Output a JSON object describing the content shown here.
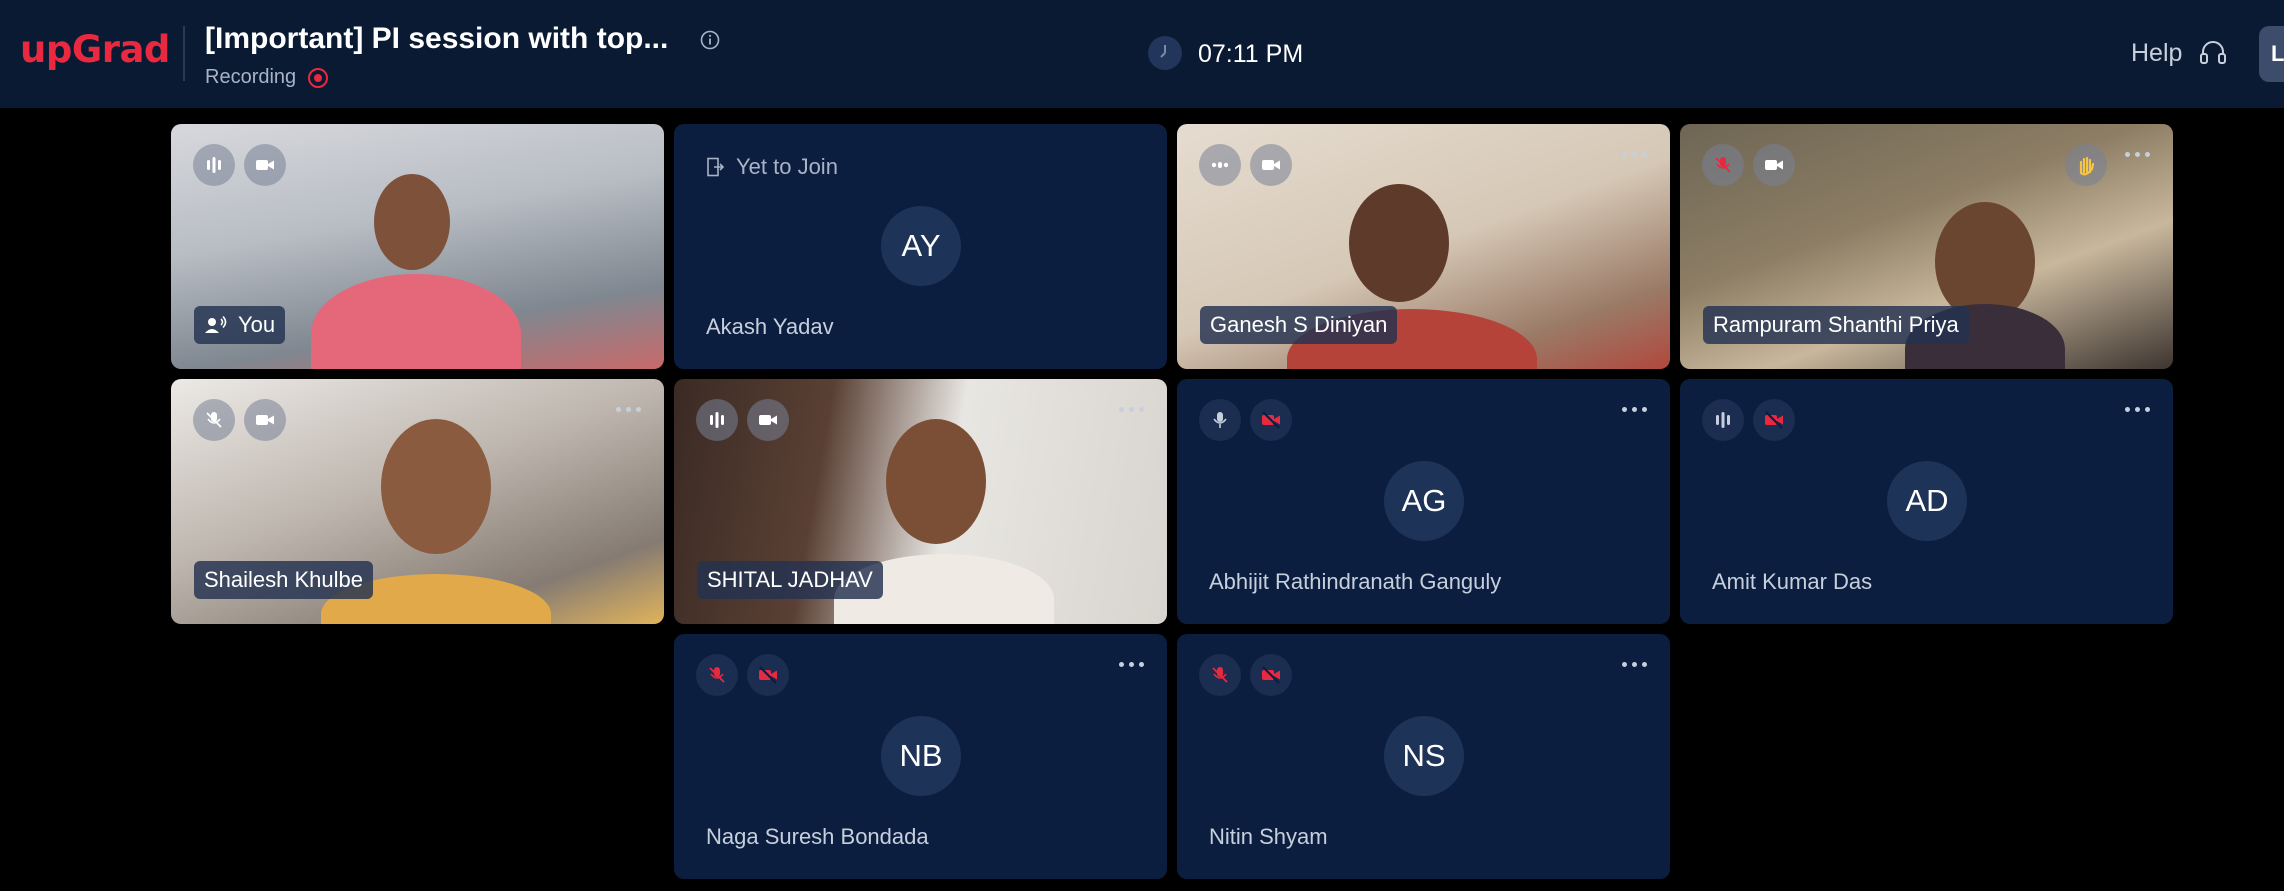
{
  "header": {
    "logo": "upGrad",
    "title": "[Important] PI session with top...",
    "recording_label": "Recording",
    "clock_time": "07:11 PM",
    "help_label": "Help",
    "user_initial": "L"
  },
  "tiles": [
    {
      "name": "You",
      "type": "video",
      "mic": "on",
      "camera": "on"
    },
    {
      "name": "Akash Yadav",
      "initials": "AY",
      "status": "Yet to Join",
      "type": "pending"
    },
    {
      "name": "Ganesh S Diniyan",
      "type": "video",
      "mic": "on",
      "camera": "on"
    },
    {
      "name": "Rampuram Shanthi Priya",
      "type": "video",
      "mic": "muted",
      "camera": "on",
      "hand_raised": true
    },
    {
      "name": "Shailesh Khulbe",
      "type": "video",
      "mic": "muted",
      "camera": "on"
    },
    {
      "name": "SHITAL JADHAV",
      "type": "video",
      "mic": "on",
      "camera": "on"
    },
    {
      "name": "Abhijit Rathindranath Ganguly",
      "initials": "AG",
      "type": "avatar",
      "mic": "on",
      "camera": "off"
    },
    {
      "name": "Amit Kumar Das",
      "initials": "AD",
      "type": "avatar",
      "mic": "on",
      "camera": "off"
    },
    {
      "name": "Naga Suresh Bondada",
      "initials": "NB",
      "type": "avatar",
      "mic": "muted",
      "camera": "off"
    },
    {
      "name": "Nitin Shyam",
      "initials": "NS",
      "type": "avatar",
      "mic": "muted",
      "camera": "off"
    }
  ],
  "icons": {
    "mic_on": "audio-bars-icon",
    "mic_muted": "mic-muted-icon",
    "camera_on": "video-camera-icon",
    "camera_off": "video-off-icon",
    "more": "more-options-icon",
    "hand": "raised-hand-icon"
  },
  "colors": {
    "brand": "#e8293f",
    "header_bg": "#0b1a33",
    "tile_bg": "#0c1e3f",
    "muted_red": "#e8293f"
  }
}
